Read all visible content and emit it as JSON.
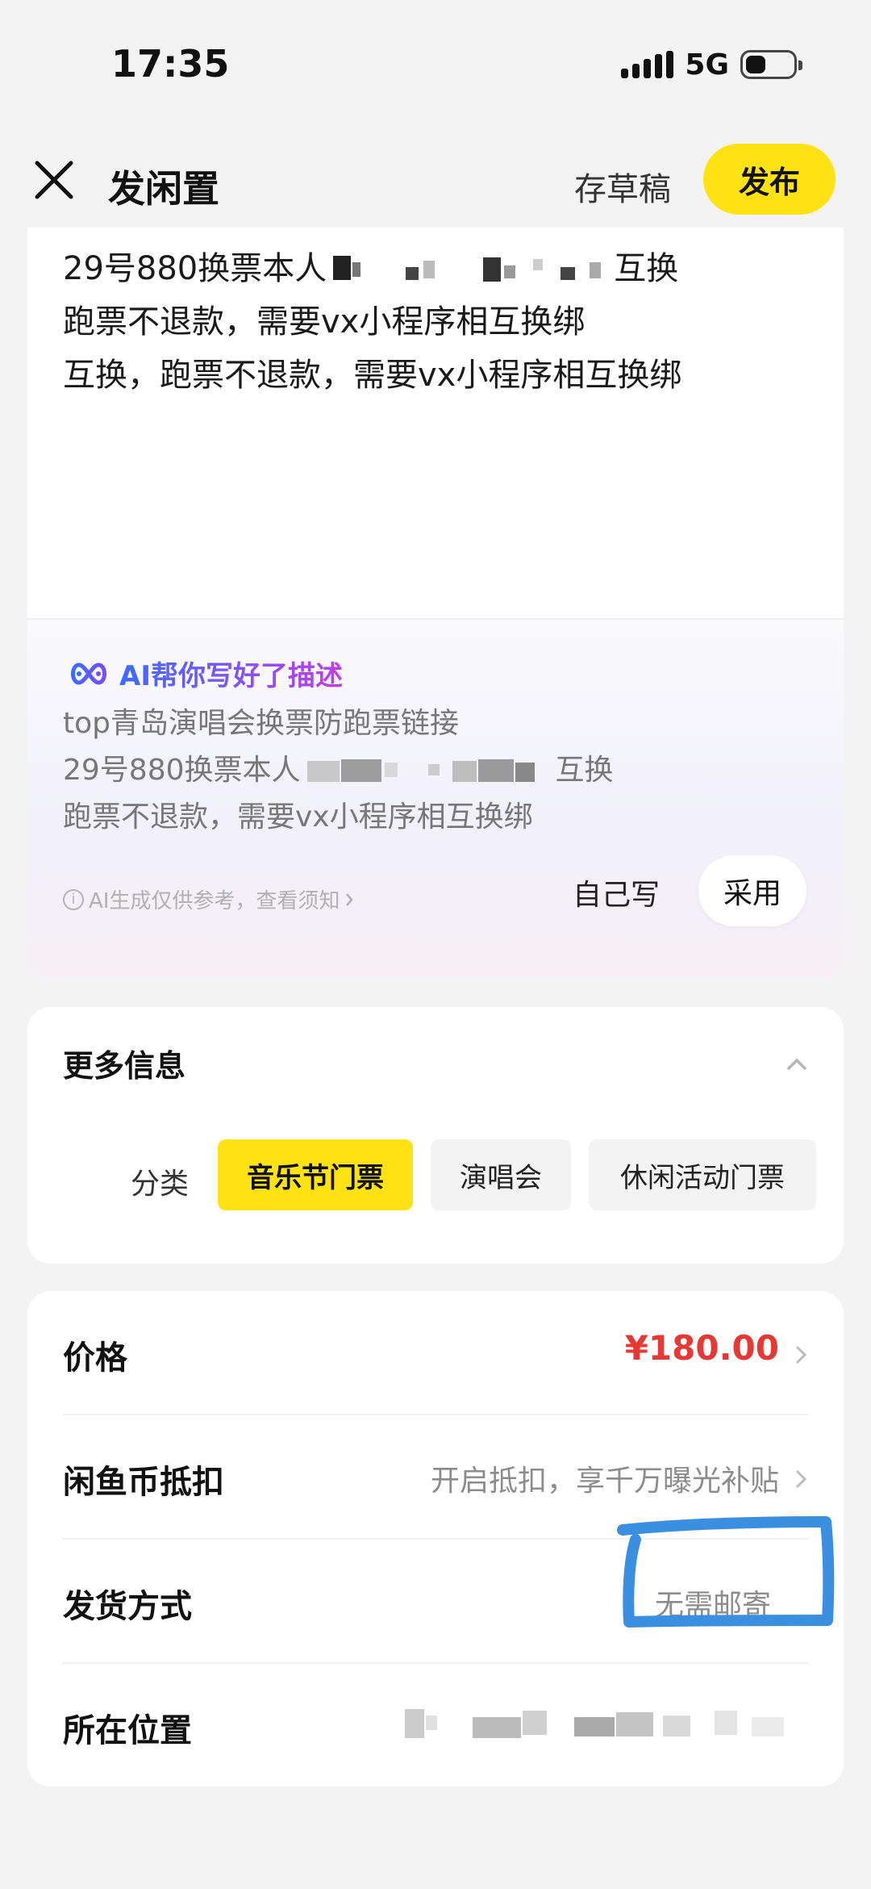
{
  "status_bar": {
    "time": "17:35",
    "network": "5G"
  },
  "header": {
    "title": "发闲置",
    "draft_label": "存草稿",
    "publish_label": "发布"
  },
  "description": {
    "line1_prefix": "29号880换票本人",
    "line1_suffix": "互换",
    "line2": "跑票不退款，需要vx小程序相互换绑",
    "line3": "互换，跑票不退款，需要vx小程序相互换绑"
  },
  "ai_panel": {
    "title": "AI帮你写好了描述",
    "line1": "top青岛演唱会换票防跑票链接",
    "line2_prefix": "29号880换票本人",
    "line2_suffix": "互换",
    "line3": "跑票不退款，需要vx小程序相互换绑",
    "note": "AI生成仅供参考，查看须知",
    "self_write_label": "自己写",
    "adopt_label": "采用"
  },
  "more_info": {
    "title": "更多信息",
    "category_label": "分类",
    "chips": [
      "音乐节门票",
      "演唱会",
      "休闲活动门票"
    ],
    "selected_chip": "音乐节门票"
  },
  "details": {
    "price_label": "价格",
    "price_value": "¥180.00",
    "coin_label": "闲鱼币抵扣",
    "coin_value": "开启抵扣，享千万曝光补贴",
    "shipping_label": "发货方式",
    "shipping_value": "无需邮寄",
    "location_label": "所在位置"
  },
  "colors": {
    "accent_yellow": "#ffe214",
    "price_red": "#e53935",
    "annotation_blue": "#3b8fe0"
  }
}
